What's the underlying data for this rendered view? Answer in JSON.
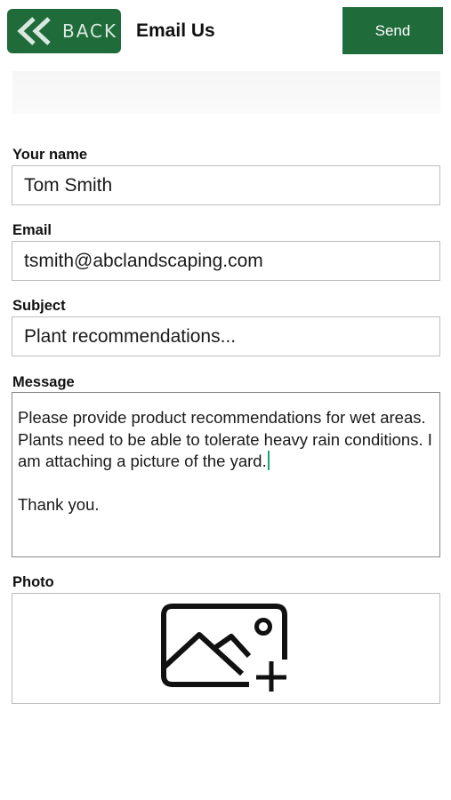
{
  "colors": {
    "brand_green": "#1f6b3a",
    "caret_teal": "#1aa37a"
  },
  "header": {
    "back_label": "BACK",
    "title": "Email Us",
    "send_label": "Send"
  },
  "form": {
    "name": {
      "label": "Your name",
      "value": "Tom Smith"
    },
    "email": {
      "label": "Email",
      "value": "tsmith@abclandscaping.com"
    },
    "subject": {
      "label": "Subject",
      "value": "Plant recommendations..."
    },
    "message": {
      "label": "Message",
      "line1": "Please provide product recommendations for wet areas. Plants need to be able to tolerate heavy rain conditions. I am attaching a picture of the yard.",
      "line2": "Thank you."
    },
    "photo": {
      "label": "Photo",
      "icon": "add-image-icon"
    }
  }
}
